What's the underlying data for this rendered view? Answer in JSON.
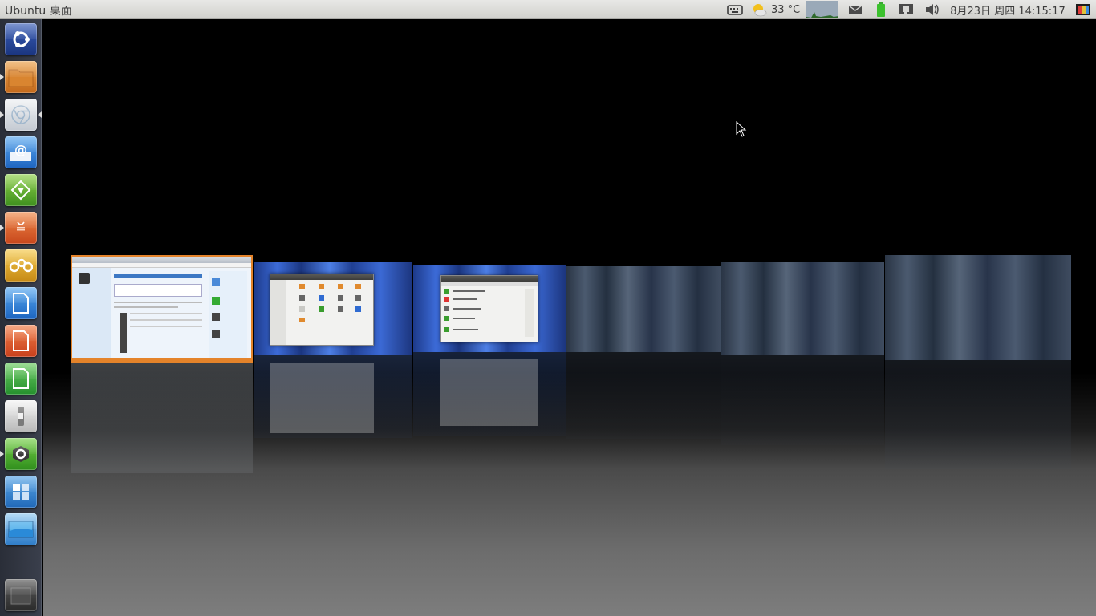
{
  "top_panel": {
    "title": "Ubuntu 桌面",
    "weather_temp": "33 °C",
    "datetime": "8月23日 周四 14:15:17"
  },
  "launcher": {
    "items": [
      {
        "name": "dash-home",
        "icon": "ubuntu-logo-icon",
        "color": "#1e3f8f"
      },
      {
        "name": "files",
        "icon": "folder-icon",
        "color": "#d9852f",
        "running": true
      },
      {
        "name": "chromium",
        "icon": "chromium-icon",
        "color": "#d8dde3",
        "running": true,
        "active": true
      },
      {
        "name": "thunderbird",
        "icon": "mail-at-icon",
        "color": "#2d7bd6"
      },
      {
        "name": "app-green",
        "icon": "diamond-icon",
        "color": "#5aa832"
      },
      {
        "name": "software-center",
        "icon": "shopping-bag-icon",
        "color": "#e2662c",
        "running": true
      },
      {
        "name": "app-yellow",
        "icon": "gear-group-icon",
        "color": "#e0a92a"
      },
      {
        "name": "writer",
        "icon": "document-icon",
        "color": "#2f85d4"
      },
      {
        "name": "impress",
        "icon": "presentation-icon",
        "color": "#e2582c"
      },
      {
        "name": "calc",
        "icon": "spreadsheet-icon",
        "color": "#3ca64a"
      },
      {
        "name": "switch",
        "icon": "switch-icon",
        "color": "#d4d4d4"
      },
      {
        "name": "system-settings",
        "icon": "settings-gear-icon",
        "color": "#3fa83a",
        "running": true
      },
      {
        "name": "workspace-switcher",
        "icon": "workspaces-icon",
        "color": "#3a86d0"
      },
      {
        "name": "desktop",
        "icon": "desktop-icon",
        "color": "#3d8fd8"
      },
      {
        "name": "trash",
        "icon": "trash-icon",
        "color": "#4a4a4a"
      }
    ]
  }
}
